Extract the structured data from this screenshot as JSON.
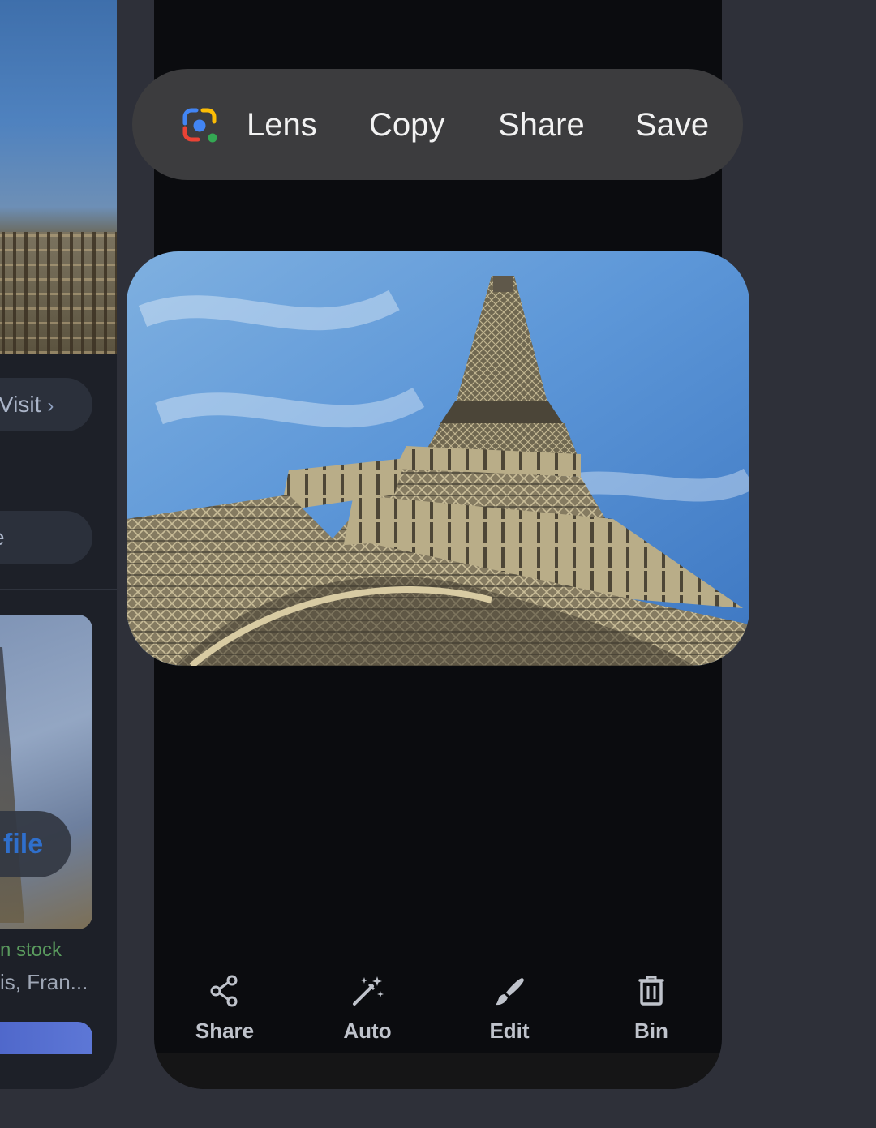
{
  "background_app": {
    "visit_label": "Visit",
    "pill_partial_label": "e",
    "file_button_label": "file",
    "stock_text": "n stock",
    "location_text": "is, Fran..."
  },
  "context_menu": {
    "items": [
      {
        "icon": "google-lens-icon",
        "label": "Lens"
      },
      {
        "icon": null,
        "label": "Copy"
      },
      {
        "icon": null,
        "label": "Share"
      },
      {
        "icon": null,
        "label": "Save"
      }
    ]
  },
  "photo": {
    "subject": "eiffel-tower-photo"
  },
  "toolbar": {
    "items": [
      {
        "icon": "share-icon",
        "label": "Share"
      },
      {
        "icon": "auto-enhance-icon",
        "label": "Auto"
      },
      {
        "icon": "edit-brush-icon",
        "label": "Edit"
      },
      {
        "icon": "trash-icon",
        "label": "Bin"
      }
    ]
  },
  "colors": {
    "screen_bg": "#2e3039",
    "card_bg": "#0b0c0f",
    "menu_bg": "#3c3c3e",
    "menu_text": "#f2f2f2",
    "toolbar_text": "#bfc3cb",
    "google_blue": "#4285F4",
    "google_red": "#EA4335",
    "google_yellow": "#FBBC05",
    "google_green": "#34A853"
  }
}
